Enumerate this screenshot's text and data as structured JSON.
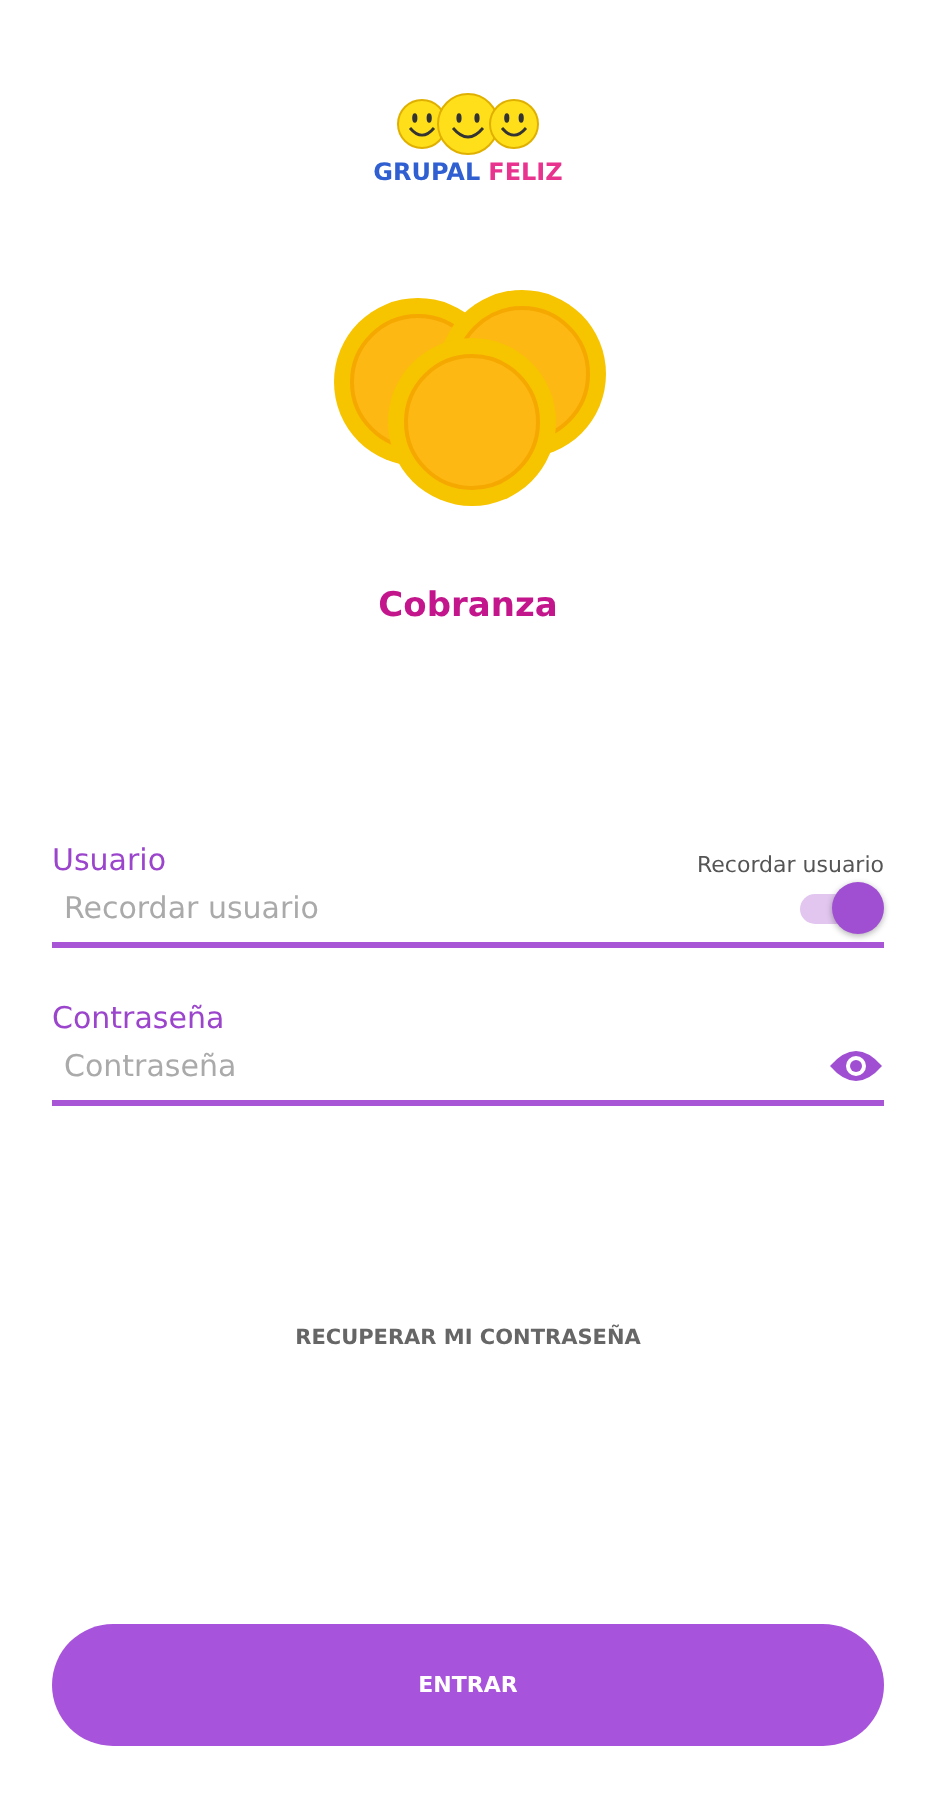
{
  "logo": {
    "word_1": "GRUPAL",
    "word_2": "FELIZ"
  },
  "title": "Cobranza",
  "user_field": {
    "label": "Usuario",
    "placeholder": "Recordar usuario",
    "remember_label": "Recordar usuario",
    "remember_on": true
  },
  "password_field": {
    "label": "Contraseña",
    "placeholder": "Contraseña"
  },
  "recover_link": "RECUPERAR MI CONTRASEÑA",
  "submit_button": "ENTRAR"
}
